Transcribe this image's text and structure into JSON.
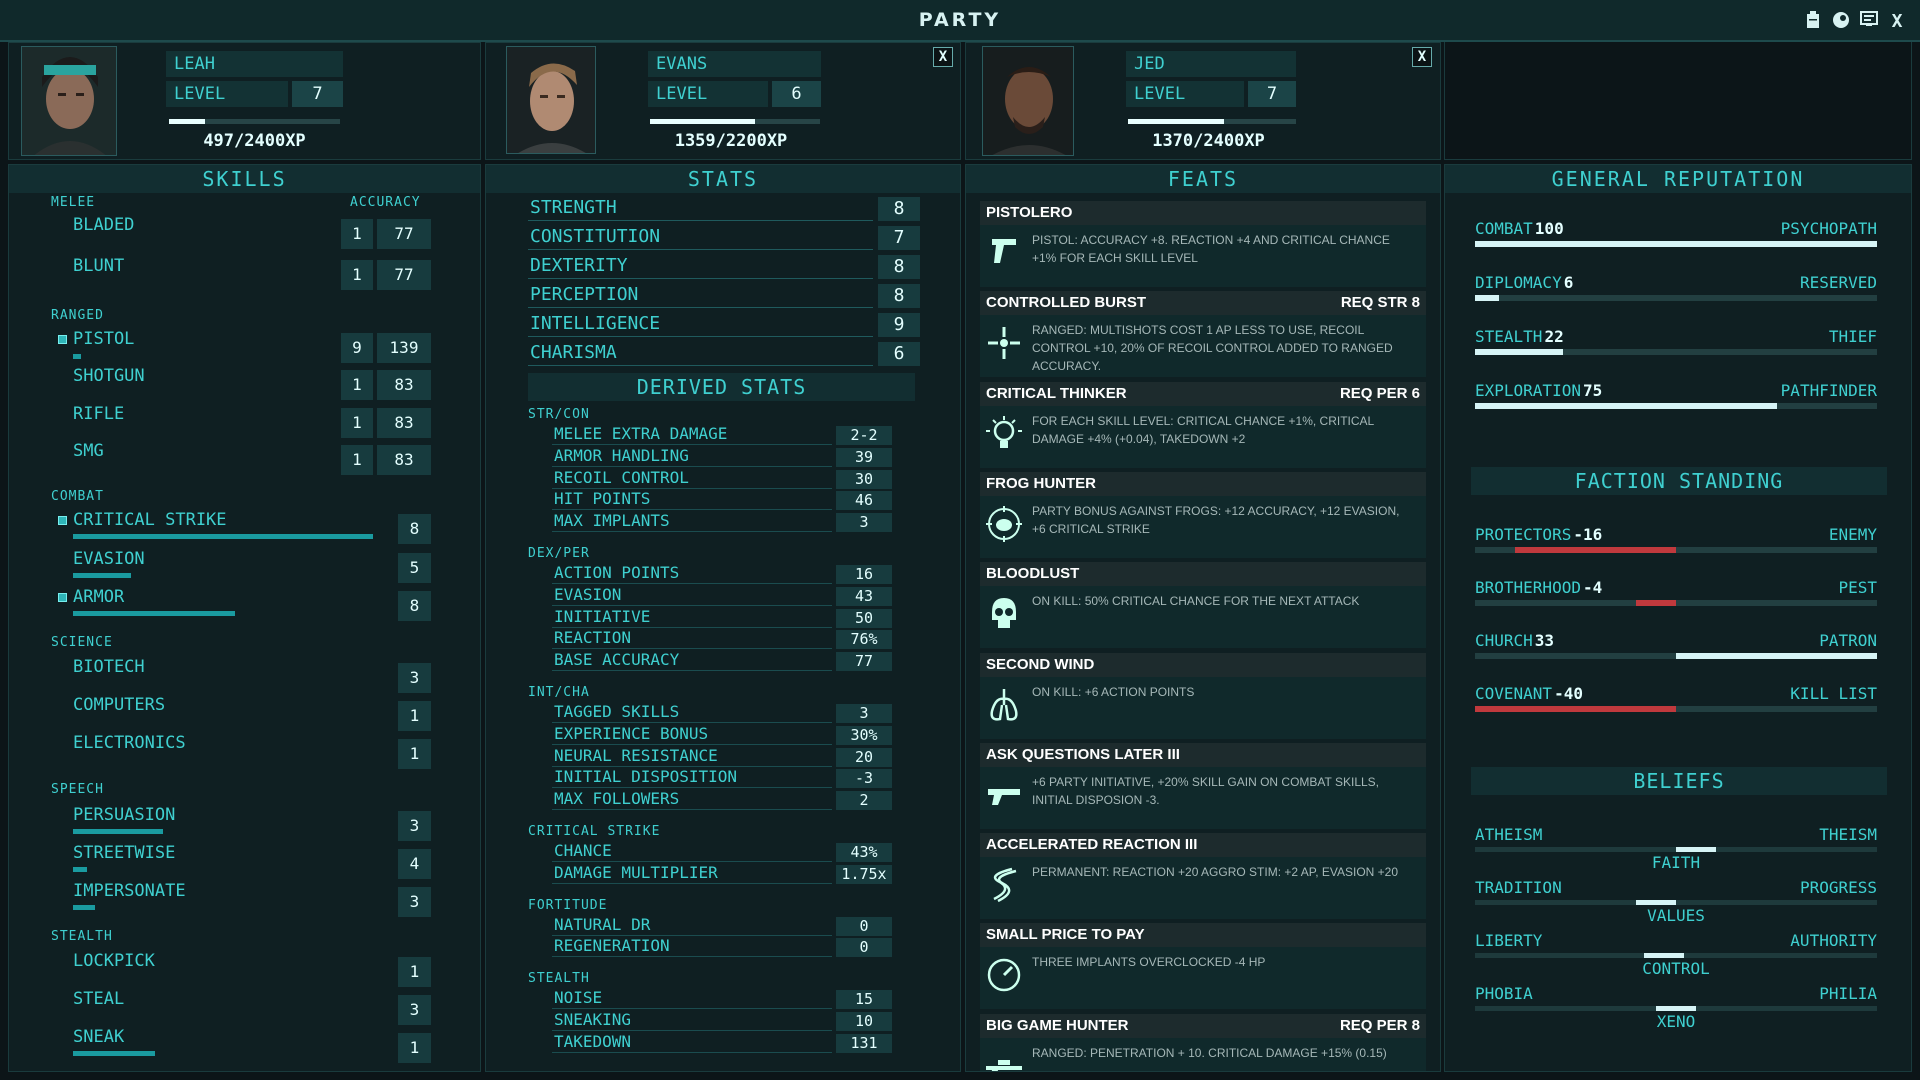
{
  "window": {
    "title": "PARTY"
  },
  "members": [
    {
      "name": "LEAH",
      "level_label": "LEVEL",
      "level": "7",
      "xp": "497/2400XP",
      "xp_frac": 0.21
    },
    {
      "name": "EVANS",
      "level_label": "LEVEL",
      "level": "6",
      "xp": "1359/2200XP",
      "xp_frac": 0.62
    },
    {
      "name": "JED",
      "level_label": "LEVEL",
      "level": "7",
      "xp": "1370/2400XP",
      "xp_frac": 0.57
    }
  ],
  "close_label": "X",
  "skills": {
    "header": "SKILLS",
    "accuracy_label": "ACCURACY",
    "groups": {
      "melee": "MELEE",
      "ranged": "RANGED",
      "combat": "COMBAT",
      "science": "SCIENCE",
      "speech": "SPEECH",
      "stealth": "STEALTH"
    },
    "items": {
      "bladed": {
        "name": "BLADED",
        "level": "1",
        "acc": "77"
      },
      "blunt": {
        "name": "BLUNT",
        "level": "1",
        "acc": "77"
      },
      "pistol": {
        "name": "PISTOL",
        "level": "9",
        "acc": "139"
      },
      "shotgun": {
        "name": "SHOTGUN",
        "level": "1",
        "acc": "83"
      },
      "rifle": {
        "name": "RIFLE",
        "level": "1",
        "acc": "83"
      },
      "smg": {
        "name": "SMG",
        "level": "1",
        "acc": "83"
      },
      "critical_strike": {
        "name": "CRITICAL STRIKE",
        "level": "8"
      },
      "evasion": {
        "name": "EVASION",
        "level": "5"
      },
      "armor": {
        "name": "ARMOR",
        "level": "8"
      },
      "biotech": {
        "name": "BIOTECH",
        "level": "3"
      },
      "computers": {
        "name": "COMPUTERS",
        "level": "1"
      },
      "electronics": {
        "name": "ELECTRONICS",
        "level": "1"
      },
      "persuasion": {
        "name": "PERSUASION",
        "level": "3"
      },
      "streetwise": {
        "name": "STREETWISE",
        "level": "4"
      },
      "impersonate": {
        "name": "IMPERSONATE",
        "level": "3"
      },
      "lockpick": {
        "name": "LOCKPICK",
        "level": "1"
      },
      "steal": {
        "name": "STEAL",
        "level": "3"
      },
      "sneak": {
        "name": "SNEAK",
        "level": "1"
      }
    }
  },
  "stats": {
    "header": "STATS",
    "items": [
      {
        "name": "STRENGTH",
        "value": "8"
      },
      {
        "name": "CONSTITUTION",
        "value": "7"
      },
      {
        "name": "DEXTERITY",
        "value": "8"
      },
      {
        "name": "PERCEPTION",
        "value": "8"
      },
      {
        "name": "INTELLIGENCE",
        "value": "9"
      },
      {
        "name": "CHARISMA",
        "value": "6"
      }
    ],
    "derived_header": "DERIVED STATS",
    "derived": [
      {
        "group": "STR/CON",
        "rows": [
          {
            "name": "MELEE EXTRA DAMAGE",
            "value": "2-2"
          },
          {
            "name": "ARMOR HANDLING",
            "value": "39"
          },
          {
            "name": "RECOIL CONTROL",
            "value": "30"
          },
          {
            "name": "HIT POINTS",
            "value": "46"
          },
          {
            "name": "MAX IMPLANTS",
            "value": "3"
          }
        ]
      },
      {
        "group": "DEX/PER",
        "rows": [
          {
            "name": "ACTION POINTS",
            "value": "16"
          },
          {
            "name": "EVASION",
            "value": "43"
          },
          {
            "name": "INITIATIVE",
            "value": "50"
          },
          {
            "name": "REACTION",
            "value": "76%"
          },
          {
            "name": "BASE ACCURACY",
            "value": "77"
          }
        ]
      },
      {
        "group": "INT/CHA",
        "rows": [
          {
            "name": "TAGGED SKILLS",
            "value": "3"
          },
          {
            "name": "EXPERIENCE BONUS",
            "value": "30%"
          },
          {
            "name": "NEURAL RESISTANCE",
            "value": "20"
          },
          {
            "name": "INITIAL DISPOSITION",
            "value": "-3"
          },
          {
            "name": "MAX FOLLOWERS",
            "value": "2"
          }
        ]
      },
      {
        "group": "CRITICAL STRIKE",
        "rows": [
          {
            "name": "CHANCE",
            "value": "43%"
          },
          {
            "name": "DAMAGE MULTIPLIER",
            "value": "1.75x"
          }
        ]
      },
      {
        "group": "FORTITUDE",
        "rows": [
          {
            "name": "NATURAL DR",
            "value": "0"
          },
          {
            "name": "REGENERATION",
            "value": "0"
          }
        ]
      },
      {
        "group": "STEALTH",
        "rows": [
          {
            "name": "NOISE",
            "value": "15"
          },
          {
            "name": "SNEAKING",
            "value": "10"
          },
          {
            "name": "TAKEDOWN",
            "value": "131"
          }
        ]
      }
    ]
  },
  "feats": {
    "header": "FEATS",
    "items": [
      {
        "title": "PISTOLERO",
        "req": "",
        "desc": "PISTOL: ACCURACY +8. REACTION +4 AND CRITICAL CHANCE +1% FOR EACH SKILL LEVEL",
        "icon": "pistol-icon"
      },
      {
        "title": "CONTROLLED BURST",
        "req": "REQ STR 8",
        "desc": "RANGED: MULTISHOTS COST 1 AP LESS TO USE, RECOIL CONTROL +10, 20% OF RECOIL CONTROL ADDED TO RANGED ACCURACY.",
        "icon": "crosshair-icon"
      },
      {
        "title": "CRITICAL THINKER",
        "req": "REQ PER 6",
        "desc": "FOR EACH SKILL LEVEL: CRITICAL CHANCE +1%, CRITICAL DAMAGE +4% (+0.04), TAKEDOWN +2",
        "icon": "lightbulb-icon"
      },
      {
        "title": "FROG HUNTER",
        "req": "",
        "desc": "PARTY BONUS AGAINST FROGS: +12 ACCURACY, +12 EVASION, +6 CRITICAL STRIKE",
        "icon": "frog-target-icon"
      },
      {
        "title": "BLOODLUST",
        "req": "",
        "desc": "ON KILL: 50% CRITICAL CHANCE FOR THE NEXT ATTACK",
        "icon": "skull-icon"
      },
      {
        "title": "SECOND WIND",
        "req": "",
        "desc": "ON KILL: +6 ACTION POINTS",
        "icon": "lungs-icon"
      },
      {
        "title": "ASK QUESTIONS LATER III",
        "req": "",
        "desc": "+6 PARTY INITIATIVE, +20% SKILL GAIN ON COMBAT SKILLS, INITIAL DISPOSION -3.",
        "icon": "gun-icon"
      },
      {
        "title": "ACCELERATED REACTION III",
        "req": "",
        "desc": "PERMANENT: REACTION +20 AGGRO STIM: +2 AP, EVASION +20",
        "icon": "dna-icon"
      },
      {
        "title": "SMALL PRICE TO PAY",
        "req": "",
        "desc": "THREE IMPLANTS OVERCLOCKED -4 HP",
        "icon": "gauge-icon"
      },
      {
        "title": "BIG GAME HUNTER",
        "req": "REQ PER 8",
        "desc": "RANGED: PENETRATION + 10. CRITICAL DAMAGE +15% (0.15)",
        "icon": "sniper-icon"
      }
    ]
  },
  "reputation": {
    "header": "GENERAL REPUTATION",
    "items": [
      {
        "name": "COMBAT",
        "value": "100",
        "rank": "PSYCHOPATH",
        "frac": 1.0
      },
      {
        "name": "DIPLOMACY",
        "value": "6",
        "rank": "RESERVED",
        "frac": 0.06
      },
      {
        "name": "STEALTH",
        "value": "22",
        "rank": "THIEF",
        "frac": 0.22
      },
      {
        "name": "EXPLORATION",
        "value": "75",
        "rank": "PATHFINDER",
        "frac": 0.75
      }
    ],
    "colors": {
      "positive": "#d6f4f6",
      "negative": "#c0393d"
    }
  },
  "factions": {
    "header": "FACTION STANDING",
    "items": [
      {
        "name": "PROTECTORS",
        "value": "-16",
        "rank": "ENEMY",
        "frac": -0.8
      },
      {
        "name": "BROTHERHOOD",
        "value": "-4",
        "rank": "PEST",
        "frac": -0.2
      },
      {
        "name": "CHURCH",
        "value": "33",
        "rank": "PATRON",
        "frac": 1.0
      },
      {
        "name": "COVENANT",
        "value": "-40",
        "rank": "KILL LIST",
        "frac": -1.0
      }
    ]
  },
  "beliefs": {
    "header": "BELIEFS",
    "items": [
      {
        "left": "ATHEISM",
        "right": "THEISM",
        "center": "FAITH",
        "pos": 0.55
      },
      {
        "left": "TRADITION",
        "right": "PROGRESS",
        "center": "VALUES",
        "pos": 0.45
      },
      {
        "left": "LIBERTY",
        "right": "AUTHORITY",
        "center": "CONTROL",
        "pos": 0.47
      },
      {
        "left": "PHOBIA",
        "right": "PHILIA",
        "center": "XENO",
        "pos": 0.5
      }
    ]
  }
}
